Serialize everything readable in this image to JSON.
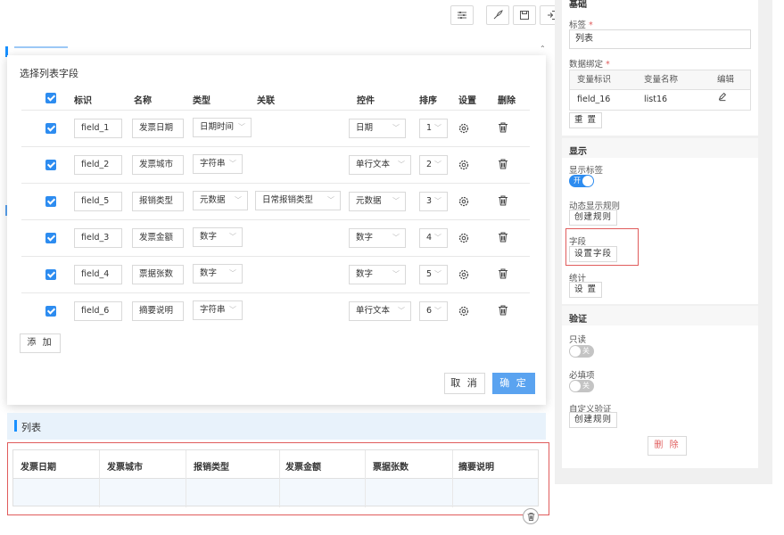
{
  "toolbar": {
    "buttons": [
      "settings-sliders-icon",
      "rocket-icon",
      "save-icon",
      "exit-icon"
    ]
  },
  "modal": {
    "title": "选择列表字段",
    "headers": [
      "标识",
      "名称",
      "类型",
      "关联",
      "控件",
      "排序",
      "设置",
      "删除"
    ],
    "rows": [
      {
        "id": "field_1",
        "name": "发票日期",
        "type": "日期时间",
        "link": "",
        "control": "日期",
        "order": "1"
      },
      {
        "id": "field_2",
        "name": "发票城市",
        "type": "字符串",
        "link": "",
        "control": "单行文本",
        "order": "2"
      },
      {
        "id": "field_5",
        "name": "报销类型",
        "type": "元数据",
        "link": "日常报销类型",
        "control": "元数据",
        "order": "3"
      },
      {
        "id": "field_3",
        "name": "发票金额",
        "type": "数字",
        "link": "",
        "control": "数字",
        "order": "4"
      },
      {
        "id": "field_4",
        "name": "票据张数",
        "type": "数字",
        "link": "",
        "control": "数字",
        "order": "5"
      },
      {
        "id": "field_6",
        "name": "摘要说明",
        "type": "字符串",
        "link": "",
        "control": "单行文本",
        "order": "6"
      }
    ],
    "add_label": "添 加",
    "cancel_label": "取 消",
    "ok_label": "确 定"
  },
  "list": {
    "label": "列表",
    "columns": [
      "发票日期",
      "发票城市",
      "报销类型",
      "发票金额",
      "票据张数",
      "摘要说明"
    ]
  },
  "panel": {
    "basic_title": "基础",
    "label_field": "标签",
    "label_value": "列表",
    "binding_field": "数据绑定",
    "binding_headers": [
      "变量标识",
      "变量名称",
      "编辑"
    ],
    "binding_row": {
      "id": "field_16",
      "name": "list16"
    },
    "reset_label": "重 置",
    "display_title": "显示",
    "show_label_field": "显示标签",
    "show_label_toggle": "开",
    "dynamic_rule_field": "动态显示规则",
    "create_rule_label": "创建规则",
    "field_field": "字段",
    "set_field_label": "设置字段",
    "stats_field": "统计",
    "stats_btn_label": "设 置",
    "validate_title": "验证",
    "readonly_field": "只读",
    "readonly_toggle": "关",
    "required_field": "必填项",
    "required_toggle": "关",
    "custom_validate_field": "自定义验证",
    "custom_rule_label": "创建规则",
    "delete_label": "删 除"
  },
  "colors": {
    "accent": "#2d8cf0",
    "ok_button": "#5aa3f0",
    "highlight": "#e05c5c"
  }
}
